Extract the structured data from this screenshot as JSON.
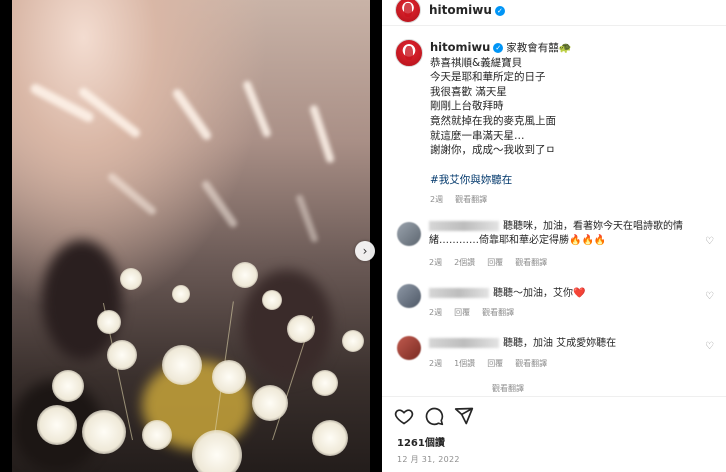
{
  "header": {
    "username": "hitomiwu",
    "verified_icon": "verified-badge-icon"
  },
  "caption": {
    "username": "hitomiwu",
    "title": "家教會有囍🐢",
    "lines": [
      "恭喜祺順&義緹寶貝",
      "今天是耶和華所定的日子",
      "我很喜歡 滿天星",
      "剛剛上台敬拜時",
      "竟然就掉在我的麥克風上面",
      "就這麼一串滿天星…",
      "謝謝你，成成～我收到了ㅁ"
    ],
    "hashtag": "#我艾你與妳聽在",
    "time": "2週",
    "translate": "觀看翻譯"
  },
  "comments": [
    {
      "text": "聽聽咪，加油，看著妳今天在唱詩歌的情緒…………倚靠耶和華必定得勝🔥🔥🔥",
      "time": "2週",
      "likes": "2個讚",
      "reply": "回覆",
      "translate": "觀看翻譯"
    },
    {
      "text": "聽聽～加油，艾你❤️",
      "time": "2週",
      "likes": "",
      "reply": "回覆",
      "translate": "觀看翻譯"
    },
    {
      "text": "聽聽，加油 艾成愛妳聽在",
      "time": "2週",
      "likes": "1個讚",
      "reply": "回覆",
      "translate": "觀看翻譯"
    },
    {
      "text": "",
      "time": "",
      "likes": "",
      "reply": "",
      "translate": "觀看翻譯"
    }
  ],
  "actions": {
    "like_icon": "heart-icon",
    "comment_icon": "comment-icon",
    "share_icon": "share-icon",
    "likes_count": "1261個讚",
    "date": "12 月 31, 2022"
  },
  "photo": {
    "next_icon": "chevron-right-icon",
    "next_glyph": "›"
  }
}
